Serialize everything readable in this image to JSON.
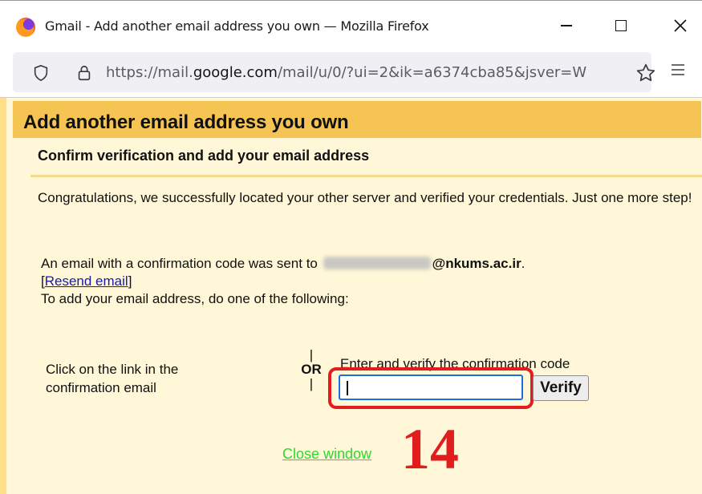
{
  "window": {
    "title": "Gmail - Add another email address you own — Mozilla Firefox",
    "icon": "firefox-icon"
  },
  "urlbar": {
    "url_prefix": "https://mail.",
    "url_domain": "google.com",
    "url_suffix": "/mail/u/0/?ui=2&ik=a6374cba85&jsver=W"
  },
  "page": {
    "header_title": "Add another email address you own",
    "sub_title": "Confirm verification and add your email address",
    "congrats": "Congratulations, we successfully located your other server and verified your credentials. Just one more step!",
    "sent_text": "An email with a confirmation code was sent to",
    "email_domain": "@nkums.ac.ir",
    "sent_end": ".",
    "resend_open": "[",
    "resend_link": "Resend email",
    "resend_close": "]",
    "instruction": "To add your email address, do one of the following:",
    "option_click": "Click on the link in the confirmation email",
    "or_bar_top": "|",
    "or_label": "OR",
    "or_bar_bottom": "|",
    "enter_label": "Enter and verify the confirmation code",
    "code_value": "",
    "verify_label": "Verify",
    "close_link": "Close window"
  },
  "annotation": {
    "step_number": "14",
    "color": "#e21d1d"
  },
  "colors": {
    "header_bg": "#f5c452",
    "page_bg": "#fff7d7",
    "link": "#1a1aa8",
    "close_link": "#2fd82f"
  }
}
